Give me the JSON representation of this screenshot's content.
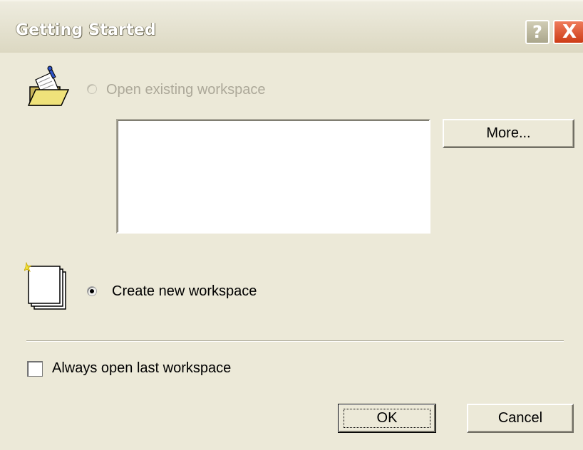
{
  "dialog": {
    "title": "Getting Started",
    "help_button": "?",
    "close_button": "X"
  },
  "open_existing": {
    "label": "Open existing workspace",
    "selected": false,
    "enabled": false,
    "icon": "open-folder-icon",
    "recent_list": [],
    "more_button": "More..."
  },
  "create_new": {
    "label": "Create new workspace",
    "selected": true,
    "icon": "new-workspace-icon"
  },
  "always_open_last": {
    "label": "Always open last workspace",
    "checked": false
  },
  "buttons": {
    "ok": "OK",
    "cancel": "Cancel"
  }
}
